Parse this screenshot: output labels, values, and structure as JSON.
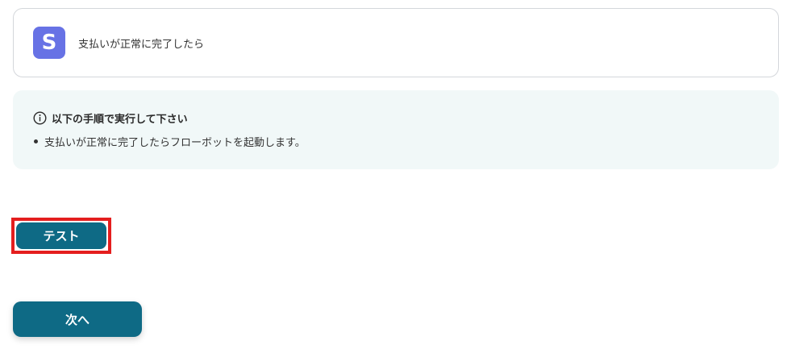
{
  "trigger": {
    "app_icon": "stripe-s-icon",
    "app_letter": "S",
    "app_color": "#6772e5",
    "label": "支払いが正常に完了したら"
  },
  "instructions": {
    "icon": "info-icon",
    "title": "以下の手順で実行して下さい",
    "items": [
      "支払いが正常に完了したらフローボットを起動します。"
    ]
  },
  "buttons": {
    "test_label": "テスト",
    "next_label": "次へ"
  },
  "colors": {
    "primary": "#0e6a85",
    "highlight": "#e41e1e",
    "info_bg": "#f1f8f8"
  }
}
